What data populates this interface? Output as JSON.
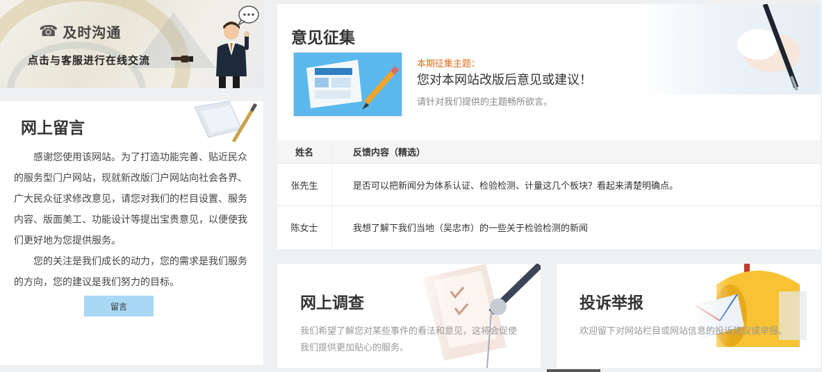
{
  "contact": {
    "title": "及时沟通",
    "subtitle": "点击与客服进行在线交流",
    "icons": [
      "phone-icon",
      "pointing-hand-icon",
      "customer-service-person-icon",
      "chat-bubble-icon"
    ]
  },
  "message": {
    "title": "网上留言",
    "paragraphs": [
      "感谢您使用该网站。为了打造功能完善、贴近民众的服务型门户网站，现就新改版门户网站向社会各界、广大民众征求修改意见，请您对我们的栏目设置、服务内容、版面美工、功能设计等提出宝贵意见，以便使我们更好地为您提供服务。",
      "您的关注是我们成长的动力，您的需求是我们服务的方向，您的建议是我们努力的目标。"
    ],
    "button_label": "留言"
  },
  "opinion": {
    "title": "意见征集",
    "topic_label": "本期征集主题：",
    "topic": "您对本网站改版后意见或建议！",
    "hint": "请针对我们提供的主题畅所欲言。",
    "table": {
      "headers": [
        "姓名",
        "反馈内容（精选）"
      ],
      "rows": [
        [
          "张先生",
          "是否可以把新闻分为体系认证、检验检测、计量这几个板块？看起来清楚明确点。"
        ],
        [
          "陈女士",
          "我想了解下我们当地（吴忠市）的一些关于检验检测的新闻"
        ]
      ]
    }
  },
  "survey": {
    "title": "网上调查",
    "desc": "我们希望了解您对某些事件的看法和意见，这将会促使我们提供更加贴心的服务。"
  },
  "report": {
    "title": "投诉举报",
    "desc": "欢迎留下对网站栏目或网站信息的投诉建议或举报。"
  },
  "colors": {
    "accent_orange": "#e06a17",
    "button_blue": "#a9d8f5",
    "page_bg": "#eef0f2"
  }
}
